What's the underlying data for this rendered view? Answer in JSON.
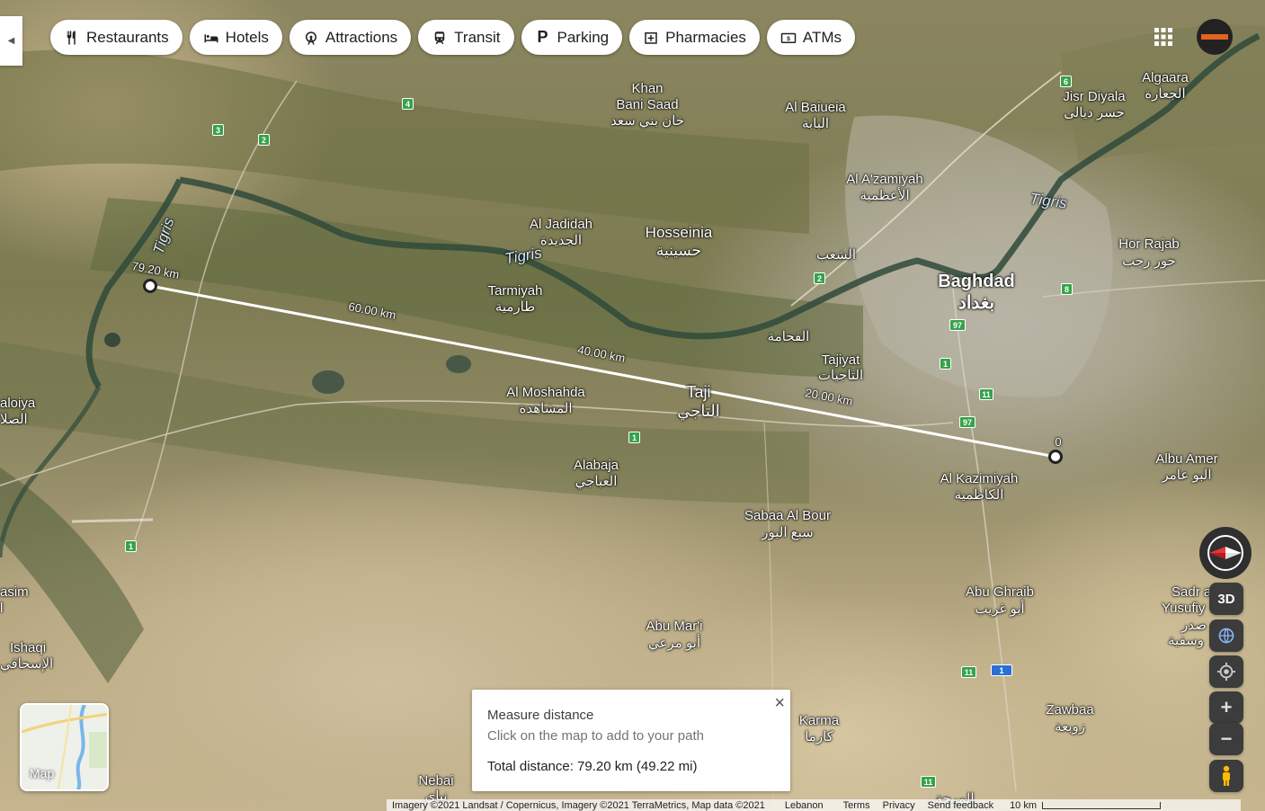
{
  "chips": [
    {
      "label": "Restaurants",
      "icon": "fork-knife-icon"
    },
    {
      "label": "Hotels",
      "icon": "bed-icon"
    },
    {
      "label": "Attractions",
      "icon": "ferris-wheel-icon"
    },
    {
      "label": "Transit",
      "icon": "train-icon"
    },
    {
      "label": "Parking",
      "icon": "parking-icon"
    },
    {
      "label": "Pharmacies",
      "icon": "pharmacy-icon"
    },
    {
      "label": "ATMs",
      "icon": "atm-icon"
    }
  ],
  "places": {
    "khan": "Khan",
    "bani_saad": "Bani Saad",
    "bani_saad_ar": "خان بني سعد",
    "al_baiueia": "Al Baiueia",
    "al_baiueia_ar": "البابة",
    "jisr_diyala": "Jisr Diyala",
    "jisr_diyala_ar": "جسر ديالى",
    "algaara": "Algaara",
    "algaara_ar": "الجعارة",
    "al_azamiyah": "Al A'zamiyah",
    "al_azamiyah_ar": "الأعظمية",
    "tigris_1": "Tigris",
    "tigris_2": "Tigris",
    "tigris_3": "Tigris",
    "al_jadidah": "Al Jadidah",
    "al_jadidah_ar": "الجديدة",
    "hosseinia": "Hosseinia",
    "hosseinia_ar": "حسينية",
    "shaab_ar": "الشعب",
    "hor_rajab": "Hor Rajab",
    "hor_rajab_ar": "حور رجب",
    "baghdad": "Baghdad",
    "baghdad_ar": "بغداد",
    "tarmiyah": "Tarmiyah",
    "tarmiyah_ar": "طارمية",
    "fahhama_ar": "الفحامة",
    "tajiyat": "Tajiyat",
    "tajiyat_ar": "التاجيات",
    "al_moshahda": "Al Moshahda",
    "al_moshahda_ar": "المشاهدة",
    "taji": "Taji",
    "taji_ar": "التاجي",
    "aloiya": "aloiya",
    "aloiya_ar": "الصلا",
    "alabaja": "Alabaja",
    "alabaja_ar": "العباجي",
    "al_kazimiyah": "Al Kazimiyah",
    "al_kazimiyah_ar": "الكاظمية",
    "albu_amer": "Albu Amer",
    "albu_amer_ar": "البو عامر",
    "sabaa_al_bour": "Sabaa Al Bour",
    "sabaa_al_bour_ar": "سبع البور",
    "asim": "asim",
    "asim_2": "l",
    "abu_ghraib": "Abu Ghraib",
    "abu_ghraib_ar": "أبو غريب",
    "sadr": "Sadr a",
    "yusufiy": "Yusufiy",
    "sadr_ar": "صدر",
    "yusufiy_ar": "وسفية",
    "ishaqi": "Ishaqi",
    "ishaqi_ar": "الإسحاقي",
    "abu_mari": "Abu Mar'i",
    "abu_mari_ar": "أبو مرعي",
    "karma": "Karma",
    "karma_ar": "كارما",
    "zawbaa": "Zawbaa",
    "zawbaa_ar": "زوبعة",
    "nebai": "Nebai",
    "nebai_ar": "نباي",
    "bottom_ar": "المرحة"
  },
  "shields": [
    "4",
    "3",
    "2",
    "6",
    "2",
    "8",
    "97",
    "1",
    "11",
    "97",
    "1",
    "1",
    "11",
    "1",
    "11"
  ],
  "measure_labels": {
    "end": "79.20 km",
    "d60": "60.00 km",
    "d40": "40.00 km",
    "d20": "20.00 km",
    "start": "0"
  },
  "measure_card": {
    "title": "Measure distance",
    "subtitle": "Click on the map to add to your path",
    "total": "Total distance: 79.20 km (49.22 mi)",
    "close": "×"
  },
  "minimap": {
    "label": "Map"
  },
  "controls": {
    "three_d": "3D",
    "zoom_in": "+",
    "zoom_out": "−"
  },
  "footer": {
    "attribution": "Imagery ©2021 Landsat / Copernicus, Imagery ©2021 TerraMetrics, Map data ©2021",
    "country": "Lebanon",
    "terms": "Terms",
    "privacy": "Privacy",
    "feedback": "Send feedback",
    "scale": "10 km"
  },
  "colors": {
    "accent": "#1a73e8",
    "compass_red": "#e53935",
    "road_shield": "#36a24a"
  }
}
